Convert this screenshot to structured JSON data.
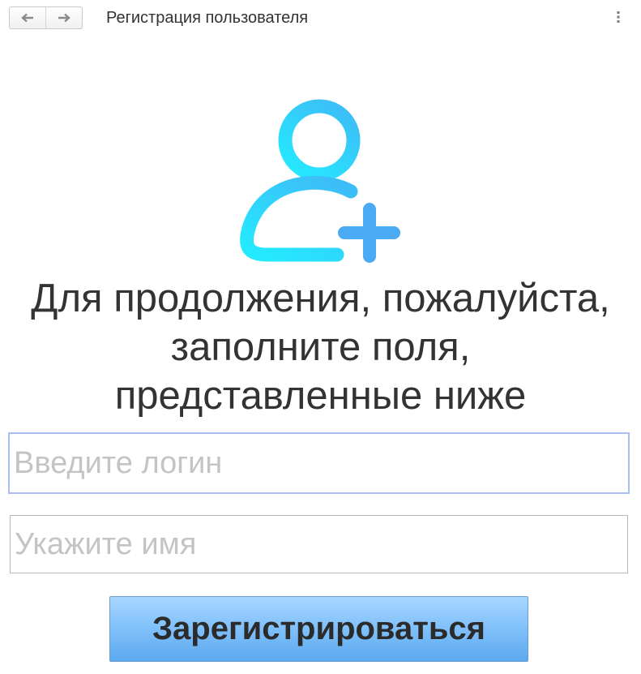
{
  "window": {
    "title": "Регистрация пользователя"
  },
  "navigation": {
    "back_icon": "arrow-left-icon",
    "forward_icon": "arrow-right-icon",
    "menu_icon": "more-vertical-icon"
  },
  "form": {
    "icon": "user-add-icon",
    "prompt_lines": [
      "Для продолжения, пожалуйста,",
      "заполните поля,",
      "представленные ниже"
    ],
    "login": {
      "value": "",
      "placeholder": "Введите логин"
    },
    "name": {
      "value": "",
      "placeholder": "Укажите имя"
    },
    "submit_label": "Зарегистрироваться"
  },
  "colors": {
    "icon_gradient_start": "#35cdfc",
    "icon_gradient_end": "#26e8ff",
    "plus_color": "#4aaaf4",
    "login_focus_border": "#a9bff3",
    "button_top": "#a8d7ff",
    "button_bottom": "#5ca9ee"
  }
}
